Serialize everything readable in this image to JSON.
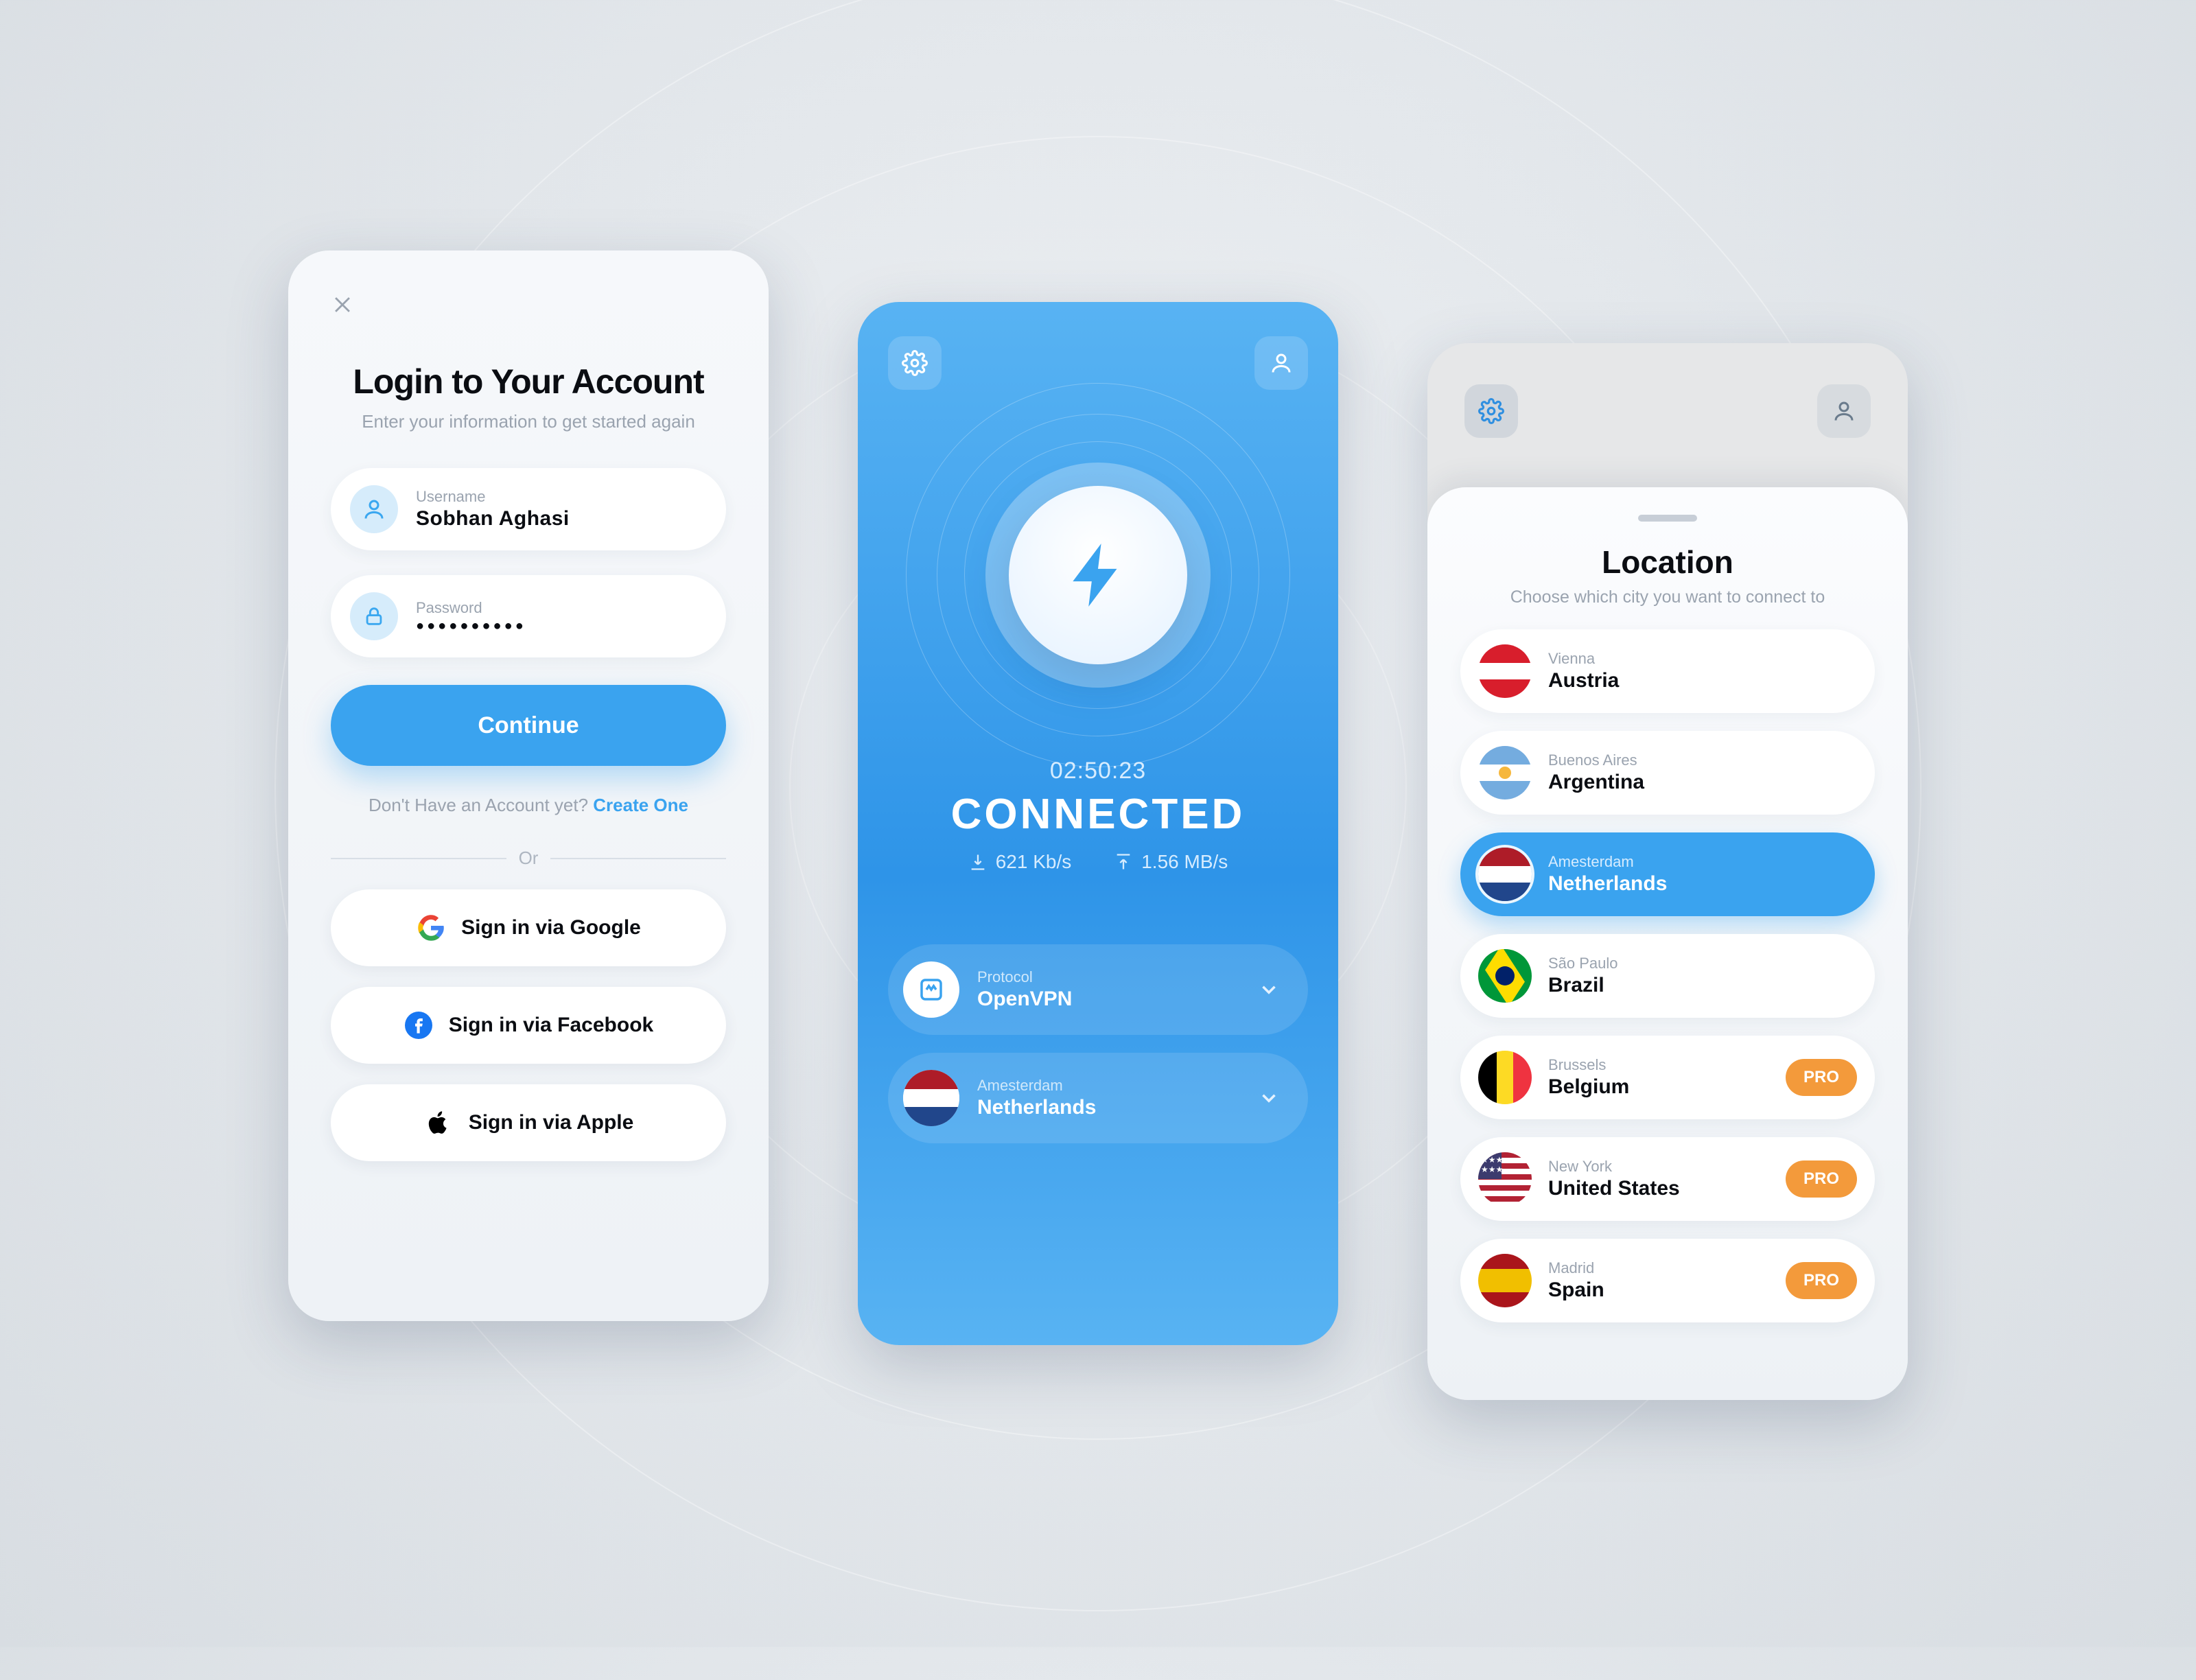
{
  "colors": {
    "accent": "#3aa3ef",
    "pro": "#f39a3b"
  },
  "login": {
    "title": "Login to Your Account",
    "subtitle": "Enter your information to get started again",
    "username_label": "Username",
    "username_value": "Sobhan Aghasi",
    "password_label": "Password",
    "password_value": "●●●●●●●●●●",
    "continue_label": "Continue",
    "signup_prefix": "Don't Have an Account yet? ",
    "signup_link": "Create One",
    "or_label": "Or",
    "social": {
      "google": "Sign in via Google",
      "facebook": "Sign in via Facebook",
      "apple": "Sign in via Apple"
    }
  },
  "connected": {
    "timer": "02:50:23",
    "status": "CONNECTED",
    "download": "621 Kb/s",
    "upload": "1.56 MB/s",
    "protocol_label": "Protocol",
    "protocol_value": "OpenVPN",
    "location_city": "Amesterdam",
    "location_country": "Netherlands"
  },
  "location": {
    "title": "Location",
    "subtitle": "Choose which city you want to connect to",
    "pro_label": "PRO",
    "items": [
      {
        "city": "Vienna",
        "country": "Austria",
        "flag": "austria",
        "selected": false,
        "pro": false
      },
      {
        "city": "Buenos Aires",
        "country": "Argentina",
        "flag": "argentina",
        "selected": false,
        "pro": false
      },
      {
        "city": "Amesterdam",
        "country": "Netherlands",
        "flag": "netherlands",
        "selected": true,
        "pro": false
      },
      {
        "city": "São Paulo",
        "country": "Brazil",
        "flag": "brazil",
        "selected": false,
        "pro": false
      },
      {
        "city": "Brussels",
        "country": "Belgium",
        "flag": "belgium",
        "selected": false,
        "pro": true
      },
      {
        "city": "New York",
        "country": "United States",
        "flag": "usa",
        "selected": false,
        "pro": true
      },
      {
        "city": "Madrid",
        "country": "Spain",
        "flag": "spain",
        "selected": false,
        "pro": true
      }
    ]
  }
}
